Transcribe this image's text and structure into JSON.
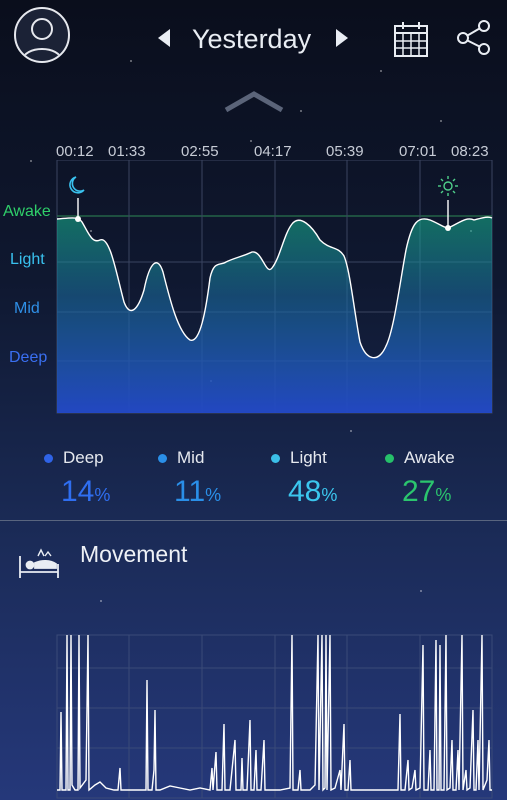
{
  "header": {
    "title": "Yesterday",
    "prev_icon": "chevron-left-icon",
    "next_icon": "chevron-right-icon",
    "calendar_icon": "calendar-icon",
    "share_icon": "share-icon",
    "avatar_icon": "user-avatar-icon"
  },
  "sleep_chart": {
    "time_ticks": [
      "00:12",
      "01:33",
      "02:55",
      "04:17",
      "05:39",
      "07:01",
      "08:23"
    ],
    "stages": {
      "awake": "Awake",
      "light": "Light",
      "mid": "Mid",
      "deep": "Deep"
    },
    "start_icon": "moon-icon",
    "end_icon": "sun-icon"
  },
  "summary": {
    "items": [
      {
        "label": "Deep",
        "value": "14",
        "unit": "%",
        "color": "#2f63e6"
      },
      {
        "label": "Mid",
        "value": "11",
        "unit": "%",
        "color": "#2a8fe8"
      },
      {
        "label": "Light",
        "value": "48",
        "unit": "%",
        "color": "#3bbfe8"
      },
      {
        "label": "Awake",
        "value": "27",
        "unit": "%",
        "color": "#26c06a"
      }
    ]
  },
  "movement": {
    "title": "Movement",
    "icon": "bed-movement-icon"
  },
  "colors": {
    "awake": "#2fcf6a",
    "light": "#39c1ee",
    "mid": "#2f8fe6",
    "deep": "#2f63e6"
  }
}
